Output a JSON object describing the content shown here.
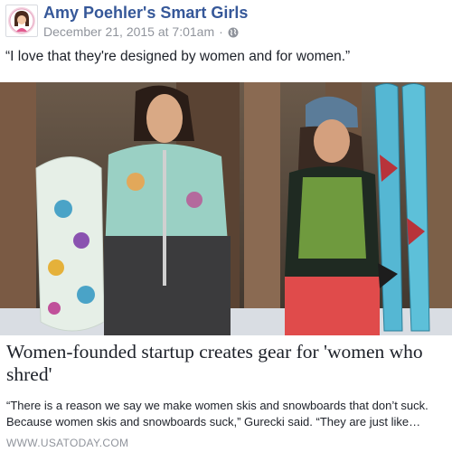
{
  "post": {
    "page_name": "Amy Poehler's Smart Girls",
    "date": "December 21, 2015 at 7:01am",
    "separator": "·",
    "privacy_icon": "globe-icon",
    "message": "“I love that they're designed by women and for women.”"
  },
  "link": {
    "headline": "Women-founded startup creates gear for 'women who shred'",
    "description": "“There is a reason we say we make women skis and snowboards that don’t suck. Because women skis and snowboards suck,” Gurecki said. “They are just like…",
    "source": "WWW.USATODAY.COM"
  },
  "colors": {
    "link_blue": "#365899",
    "meta_gray": "#90949c",
    "text": "#1d2129"
  }
}
